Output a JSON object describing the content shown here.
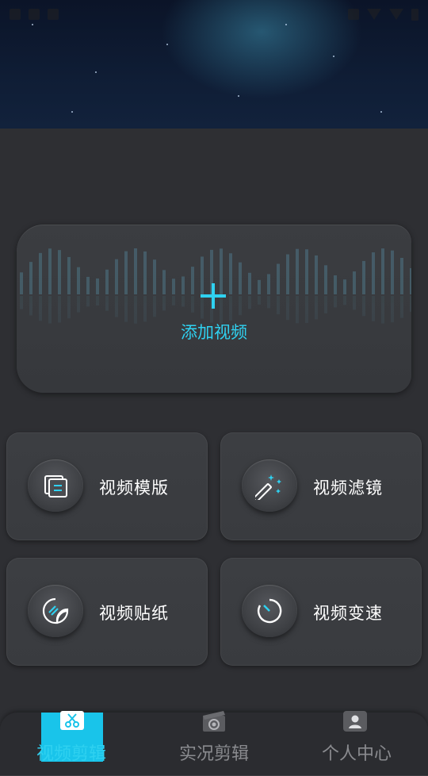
{
  "add_video": {
    "label": "添加视频"
  },
  "features": [
    {
      "label": "视频模版",
      "icon": "template-icon"
    },
    {
      "label": "视频滤镜",
      "icon": "magic-wand-icon"
    },
    {
      "label": "视频贴纸",
      "icon": "sticker-icon"
    },
    {
      "label": "视频变速",
      "icon": "speed-dial-icon"
    }
  ],
  "tabs": [
    {
      "label": "视频剪辑",
      "icon": "scissors-film-icon",
      "active": true
    },
    {
      "label": "实况剪辑",
      "icon": "live-clip-icon",
      "active": false
    },
    {
      "label": "个人中心",
      "icon": "person-icon",
      "active": false
    }
  ],
  "colors": {
    "accent": "#2fd1f0",
    "background": "#2e2f33",
    "card": "#3a3c40"
  }
}
